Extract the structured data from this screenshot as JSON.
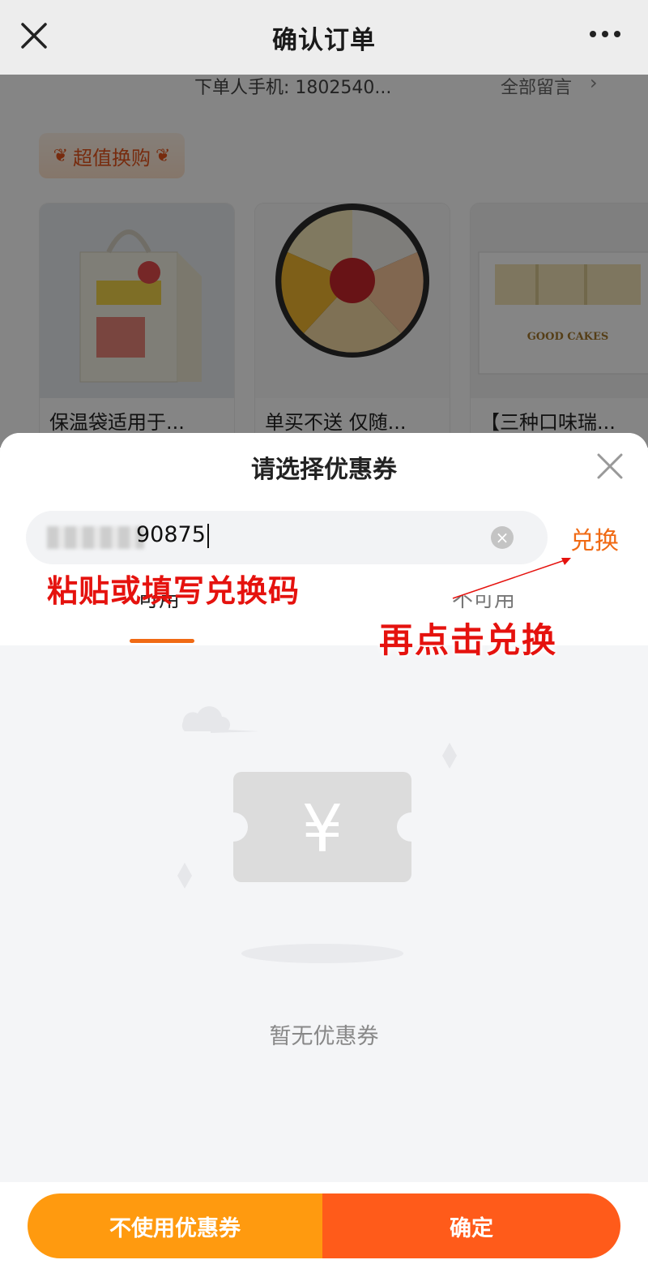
{
  "topbar": {
    "title": "确认订单",
    "close_icon": "close-icon",
    "more_icon": "more-dots-icon"
  },
  "background_page": {
    "phone_text": "下单人手机: 1802540...",
    "all_messages": "全部留言",
    "promo_label": "超值换购",
    "products": [
      {
        "name": "保温袋适用于..."
      },
      {
        "name": "单买不送 仅随..."
      },
      {
        "name": "【三种口味瑞..."
      }
    ]
  },
  "sheet": {
    "title": "请选择优惠券",
    "search": {
      "value": "90875"
    },
    "redeem_label": "兑换",
    "tabs": [
      "可用",
      "不可用"
    ],
    "annotation_paste": "粘贴或填写兑换码",
    "annotation_click": "再点击兑换",
    "empty_text": "暂无优惠券",
    "currency_symbol": "¥"
  },
  "footer": {
    "no_coupon_label": "不使用优惠券",
    "confirm_label": "确定"
  },
  "colors": {
    "accent": "#f06a14",
    "btn_left": "#ff9a0f",
    "btn_right": "#ff5b1a",
    "annotation": "#e5120e"
  }
}
